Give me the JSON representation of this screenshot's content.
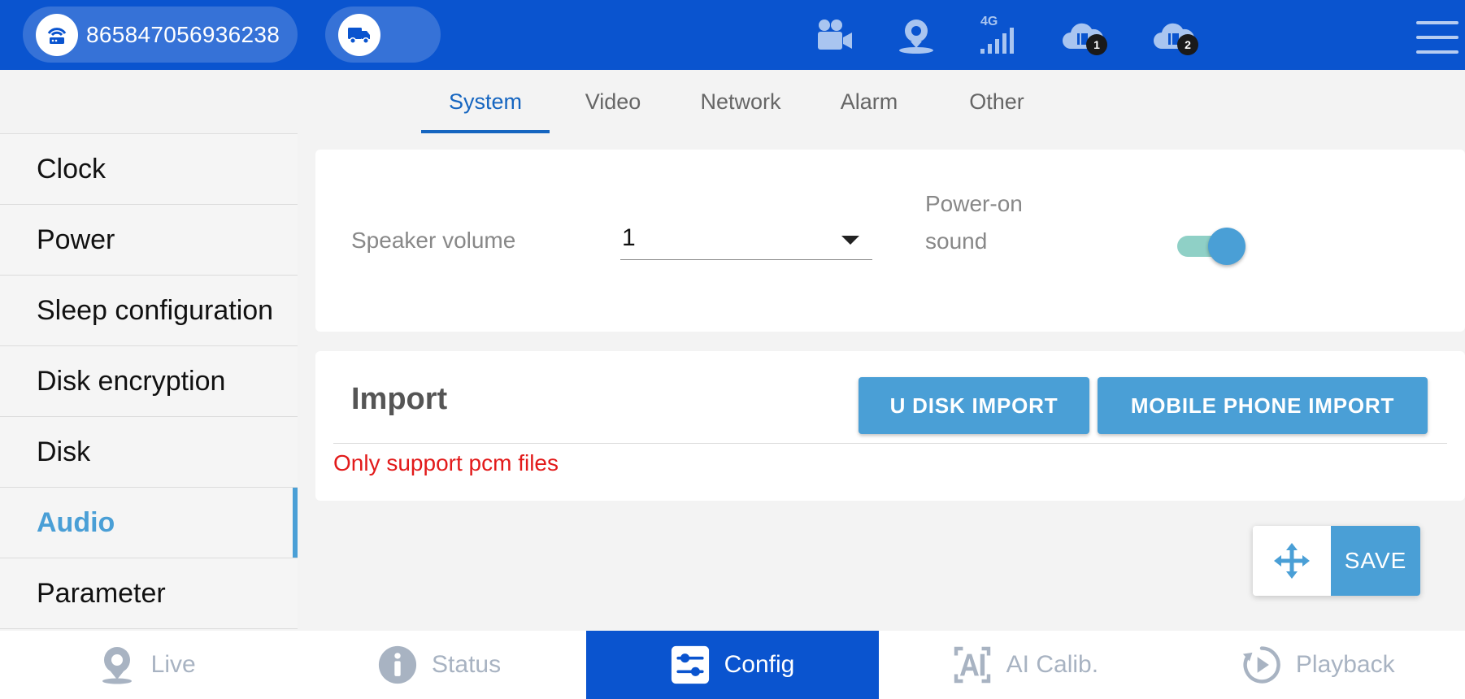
{
  "header": {
    "device_id": "865847056936238",
    "badges": [
      "1",
      "2"
    ],
    "signal_label": "4G"
  },
  "tabs": [
    {
      "label": "System",
      "active": true
    },
    {
      "label": "Video",
      "active": false
    },
    {
      "label": "Network",
      "active": false
    },
    {
      "label": "Alarm",
      "active": false
    },
    {
      "label": "Other",
      "active": false
    }
  ],
  "sidebar": {
    "items": [
      {
        "label": "Clock"
      },
      {
        "label": "Power"
      },
      {
        "label": "Sleep configuration"
      },
      {
        "label": "Disk encryption"
      },
      {
        "label": "Disk"
      },
      {
        "label": "Audio",
        "active": true
      },
      {
        "label": "Parameter"
      }
    ]
  },
  "audio": {
    "speaker_volume_label": "Speaker volume",
    "speaker_volume_value": "1",
    "power_on_sound_label": "Power-on sound",
    "power_on_sound_enabled": true
  },
  "import": {
    "title": "Import",
    "udisk_button": "U DISK IMPORT",
    "phone_button": "MOBILE PHONE IMPORT",
    "note": "Only support pcm files"
  },
  "actions": {
    "save_label": "SAVE"
  },
  "bottom_nav": [
    {
      "label": "Live",
      "icon": "webcam-icon"
    },
    {
      "label": "Status",
      "icon": "info-icon"
    },
    {
      "label": "Config",
      "icon": "sliders-icon",
      "active": true
    },
    {
      "label": "AI Calib.",
      "icon": "ai-icon"
    },
    {
      "label": "Playback",
      "icon": "playback-icon"
    }
  ],
  "colors": {
    "header_bg": "#0a54cf",
    "accent": "#4a9fd6",
    "tab_active": "#1565c0",
    "error_text": "#e21a1a",
    "nav_inactive": "#a8b3c2"
  }
}
